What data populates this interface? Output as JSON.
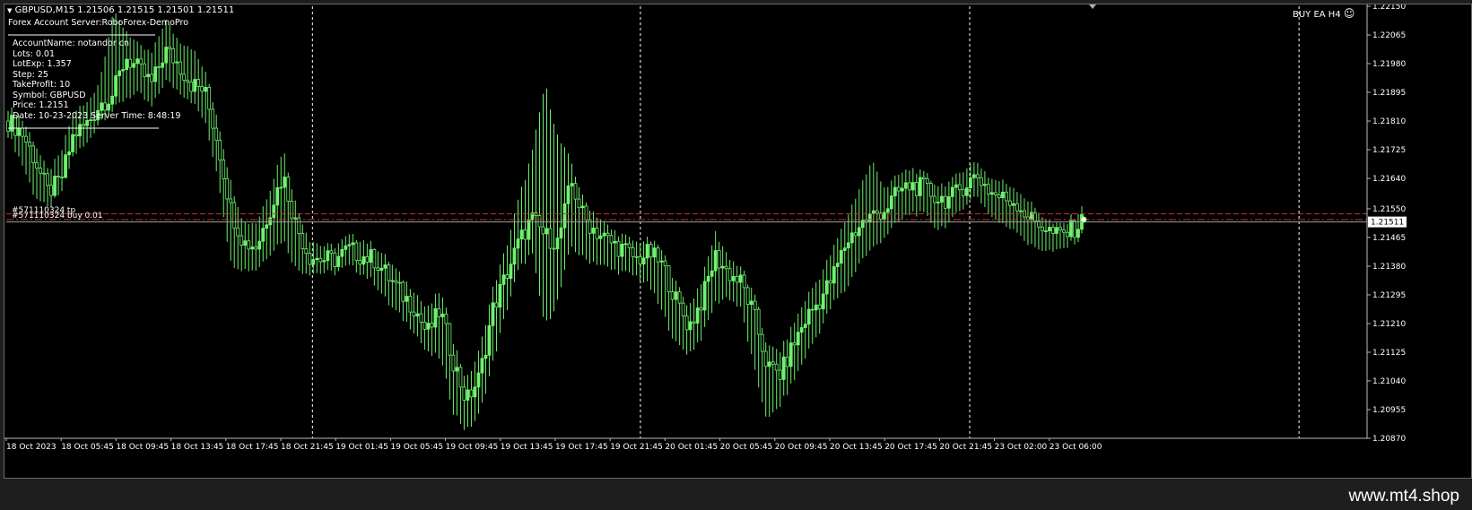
{
  "header": {
    "symbol_line": "GBPUSD,M15  1.21506 1.21515 1.21501 1.21511",
    "server_line": "Forex Account Server:RoboForex-DemoPro",
    "ea_label": "BUY EA H4"
  },
  "info_panel": [
    "AccountName:  notandor cn",
    "Lots:  0.01",
    "LotExp:  1.357",
    "Step: 25",
    "TakeProfit: 10",
    "Symbol: GBPUSD",
    "Price:  1.2151",
    "Date: 10-23-2023 Server Time: 8:48:19"
  ],
  "order_labels": [
    "#571110324 tp",
    "#571110324 buy 0.01"
  ],
  "watermark": "www.mt4.shop",
  "colors": {
    "candle": "#6ef26e",
    "grid": "#ffffff",
    "tp_line": "#cc3333",
    "entry_line": "#cc3333",
    "bid_line": "#9aa0a0",
    "bid_box": "#ffffff"
  },
  "chart_data": {
    "type": "candlestick",
    "symbol": "GBPUSD",
    "timeframe": "M15",
    "ylim": [
      1.2087,
      1.2215
    ],
    "y_ticks": [
      "1.22150",
      "1.22065",
      "1.21980",
      "1.21895",
      "1.21810",
      "1.21725",
      "1.21640",
      "1.21550",
      "1.21465",
      "1.21380",
      "1.21295",
      "1.21210",
      "1.21125",
      "1.21040",
      "1.20955",
      "1.20870"
    ],
    "x_ticks": [
      "18 Oct 2023",
      "18 Oct 05:45",
      "18 Oct 09:45",
      "18 Oct 13:45",
      "18 Oct 17:45",
      "18 Oct 21:45",
      "19 Oct 01:45",
      "19 Oct 05:45",
      "19 Oct 09:45",
      "19 Oct 13:45",
      "19 Oct 17:45",
      "19 Oct 21:45",
      "20 Oct 01:45",
      "20 Oct 05:45",
      "20 Oct 09:45",
      "20 Oct 13:45",
      "20 Oct 17:45",
      "20 Oct 21:45",
      "23 Oct 02:00",
      "23 Oct 06:00"
    ],
    "bid_price": "1.21511",
    "tp_price": 1.21535,
    "entry_price": 1.21518,
    "close_path": [
      1.2181,
      1.2178,
      1.217,
      1.216,
      1.2163,
      1.2177,
      1.218,
      1.2186,
      1.2189,
      1.22,
      1.2196,
      1.2192,
      1.2202,
      1.2198,
      1.2192,
      1.219,
      1.2175,
      1.2155,
      1.2145,
      1.2144,
      1.2155,
      1.2165,
      1.215,
      1.2141,
      1.214,
      1.214,
      1.2143,
      1.2141,
      1.214,
      1.2135,
      1.213,
      1.2126,
      1.2118,
      1.2125,
      1.211,
      1.2098,
      1.2105,
      1.2125,
      1.2135,
      1.2145,
      1.2152,
      1.2147,
      1.2145,
      1.2163,
      1.2152,
      1.2148,
      1.2145,
      1.2143,
      1.214,
      1.2142,
      1.2138,
      1.2128,
      1.212,
      1.2128,
      1.2141,
      1.2136,
      1.2133,
      1.2123,
      1.2108,
      1.2106,
      1.2115,
      1.2123,
      1.2128,
      1.2135,
      1.2145,
      1.215,
      1.2153,
      1.2155,
      1.216,
      1.2162,
      1.2161,
      1.2158,
      1.2158,
      1.2162,
      1.2165,
      1.216,
      1.2158,
      1.2157,
      1.2152,
      1.215,
      1.2147,
      1.2148,
      1.2151
    ],
    "high_path": [
      1.2184,
      1.2181,
      1.2174,
      1.2165,
      1.217,
      1.2183,
      1.2185,
      1.2192,
      1.2212,
      1.2207,
      1.2202,
      1.22,
      1.221,
      1.2204,
      1.2202,
      1.2195,
      1.2181,
      1.2162,
      1.215,
      1.215,
      1.216,
      1.2172,
      1.2155,
      1.2145,
      1.2143,
      1.2143,
      1.2146,
      1.2145,
      1.2143,
      1.2139,
      1.2134,
      1.213,
      1.2124,
      1.213,
      1.2115,
      1.2103,
      1.2112,
      1.213,
      1.2142,
      1.2157,
      1.217,
      1.2191,
      1.2175,
      1.2168,
      1.2156,
      1.2152,
      1.2148,
      1.2146,
      1.2144,
      1.2145,
      1.2141,
      1.2132,
      1.2125,
      1.2133,
      1.2147,
      1.214,
      1.2136,
      1.2128,
      1.2113,
      1.2112,
      1.212,
      1.2128,
      1.2134,
      1.2142,
      1.2151,
      1.216,
      1.2168,
      1.216,
      1.2164,
      1.2166,
      1.2164,
      1.2161,
      1.2162,
      1.2166,
      1.2168,
      1.2163,
      1.2162,
      1.216,
      1.2156,
      1.2152,
      1.2149,
      1.215,
      1.2154
    ],
    "low_path": [
      1.2178,
      1.217,
      1.216,
      1.2156,
      1.216,
      1.2172,
      1.2175,
      1.2182,
      1.2185,
      1.2189,
      1.219,
      1.2186,
      1.2194,
      1.2191,
      1.2188,
      1.2182,
      1.2166,
      1.214,
      1.2138,
      1.2138,
      1.2143,
      1.2147,
      1.2138,
      1.2137,
      1.2137,
      1.2137,
      1.2139,
      1.2137,
      1.2134,
      1.2128,
      1.2124,
      1.212,
      1.2113,
      1.2112,
      1.2096,
      1.209,
      1.2095,
      1.211,
      1.2125,
      1.2138,
      1.2143,
      1.2121,
      1.2129,
      1.2145,
      1.2141,
      1.214,
      1.2138,
      1.2137,
      1.2136,
      1.2133,
      1.2125,
      1.2116,
      1.2113,
      1.2118,
      1.2128,
      1.213,
      1.2126,
      1.2108,
      1.2093,
      1.2098,
      1.2105,
      1.2113,
      1.212,
      1.2128,
      1.2132,
      1.214,
      1.2144,
      1.2148,
      1.2152,
      1.2155,
      1.2154,
      1.215,
      1.2152,
      1.2157,
      1.216,
      1.2154,
      1.2151,
      1.215,
      1.2145,
      1.2144,
      1.2143,
      1.2145,
      1.2148
    ]
  }
}
